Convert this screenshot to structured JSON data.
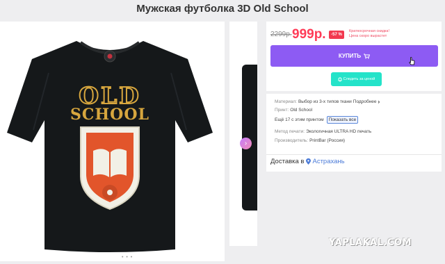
{
  "page": {
    "title": "Мужская футболка 3D Old School"
  },
  "product": {
    "print_line1": "OLD",
    "print_line2": "SCHOOL",
    "gallery_dots": "• • •"
  },
  "pricing": {
    "old_price": "2299р.",
    "new_price": "999р.",
    "discount_badge": "-57 %",
    "promo_line1": "Краткосрочная скидка!",
    "promo_line2": "Цена скоро вырастет"
  },
  "actions": {
    "buy_label": "КУПИТЬ",
    "watch_price_label": "Следить за ценой"
  },
  "details": {
    "material_label": "Материал:",
    "material_value": "Выбор из 3-х типов ткани",
    "material_more": "Подробнее",
    "print_label": "Принт:",
    "print_value": "Old School",
    "more_count_text": "Ещё 17 с этим принтом",
    "show_all_label": "Показать все",
    "method_label": "Метод печати:",
    "method_value": "Экологичная ULTRA HD печать",
    "maker_label": "Производитель:",
    "maker_value": "PrintBar (Россия)"
  },
  "delivery": {
    "label": "Доставка в",
    "city": "Астрахань"
  },
  "watermark": "YAPLAKAL.COM",
  "colors": {
    "accent_purple": "#8d5bf3",
    "price_red": "#ff3b57",
    "discount_badge": "#f2394f",
    "watch_teal": "#24e3c9",
    "city_link": "#4b7bd8",
    "shirt": "#15181a",
    "emblem_orange": "#e2552b",
    "print_gold": "#d7a63e"
  },
  "icons": [
    "chevron-right-icon",
    "cart-icon",
    "bell-icon",
    "map-pin-icon",
    "mouse-cursor-icon"
  ]
}
